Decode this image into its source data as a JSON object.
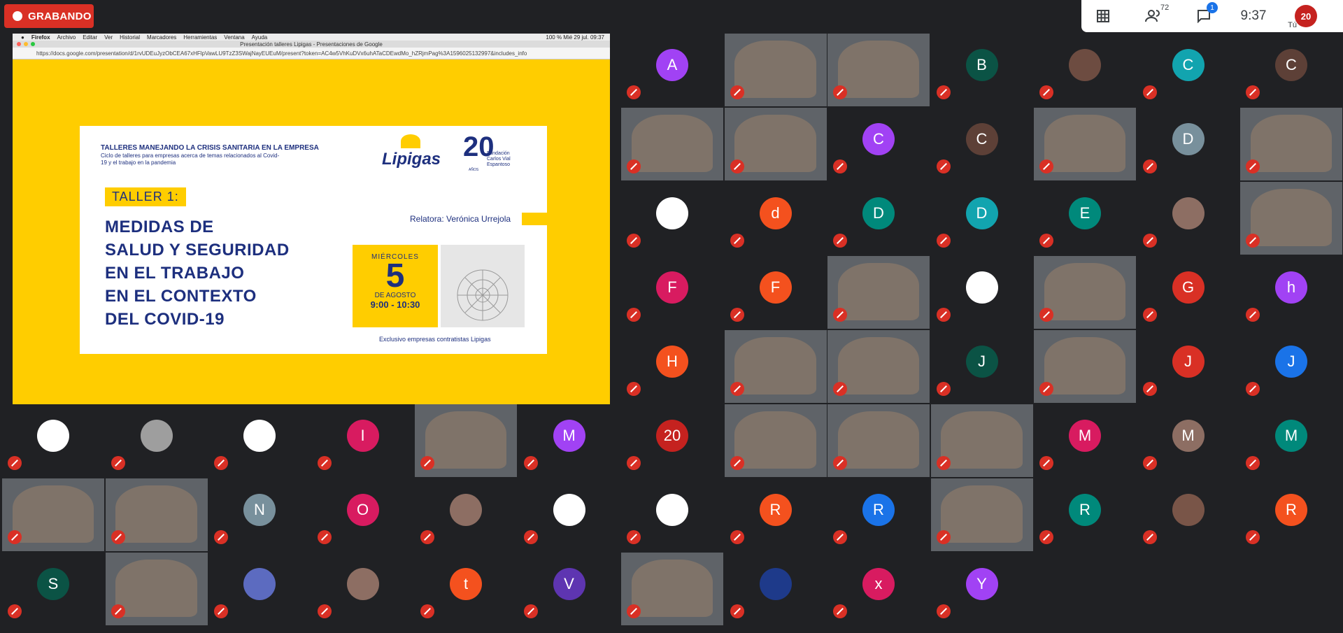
{
  "recording": {
    "label": "GRABANDO"
  },
  "topbar": {
    "participants_count": "72",
    "chat_badge": "1",
    "time": "9:37",
    "self_label": "Tú",
    "self_avatar": "20"
  },
  "presentation": {
    "mac_menu": [
      "Firefox",
      "Archivo",
      "Editar",
      "Ver",
      "Historial",
      "Marcadores",
      "Herramientas",
      "Ventana",
      "Ayuda"
    ],
    "mac_status": "100 %   Mié 29 jul.  09:37",
    "tab_title": "Presentación talleres Lipigas - Presentaciones de Google",
    "url": "https://docs.google.com/presentation/d/1rvUDEuJyzObCEA67xHFlpVawLU9TzZ3SWajNayEUEuM/present?token=AC4w5VhKuDVx6uhATaCDEwdMo_hZRjmPag%3A1596025132997&includes_info",
    "slide": {
      "header_title": "TALLERES MANEJANDO LA CRISIS SANITARIA EN LA EMPRESA",
      "header_subtitle": "Ciclo de talleres para empresas acerca de temas relacionados al Covid-19 y el trabajo en la pandemia",
      "taller": "TALLER 1:",
      "title_lines": [
        "MEDIDAS DE",
        "SALUD Y SEGURIDAD",
        "EN EL TRABAJO",
        "EN EL CONTEXTO",
        "DEL COVID-19"
      ],
      "logo_lipigas": "Lipigas",
      "logo_20": "20",
      "logo_fundacion": "Fundación Carlos Vial Espantoso",
      "logo_anos": "AÑOS",
      "relatora": "Relatora: Verónica Urrejola",
      "date_weekday": "MIÉRCOLES",
      "date_day": "5",
      "date_month": "DE AGOSTO",
      "date_time": "9:00 - 10:30",
      "exclusive": "Exclusivo empresas contratistas Lipigas"
    }
  },
  "tiles": [
    {
      "av": "A",
      "c": "#a142f4",
      "r": 0,
      "col": 0
    },
    {
      "v": 1,
      "r": 0,
      "col": 1
    },
    {
      "v": 1,
      "r": 0,
      "col": 2
    },
    {
      "av": "B",
      "c": "#0b5345",
      "r": 0,
      "col": 3
    },
    {
      "av": "",
      "c": "#6d4c41",
      "r": 0,
      "col": 4
    },
    {
      "av": "C",
      "c": "#12a4af",
      "r": 0,
      "col": 5
    },
    {
      "av": "C",
      "c": "#5d4037",
      "r": 0,
      "col": 6
    },
    {
      "v": 1,
      "r": 1,
      "col": 0
    },
    {
      "v": 1,
      "r": 1,
      "col": 1
    },
    {
      "av": "C",
      "c": "#a142f4",
      "r": 1,
      "col": 2
    },
    {
      "av": "C",
      "c": "#5d4037",
      "r": 1,
      "col": 3
    },
    {
      "v": 1,
      "r": 1,
      "col": 4
    },
    {
      "av": "D",
      "c": "#78909c",
      "r": 1,
      "col": 5
    },
    {
      "v": 1,
      "r": 1,
      "col": 6
    },
    {
      "av": "",
      "c": "#ffffff",
      "r": 2,
      "col": 0
    },
    {
      "av": "d",
      "c": "#f4511e",
      "r": 2,
      "col": 1
    },
    {
      "av": "D",
      "c": "#00897b",
      "r": 2,
      "col": 2
    },
    {
      "av": "D",
      "c": "#12a4af",
      "r": 2,
      "col": 3
    },
    {
      "av": "E",
      "c": "#00897b",
      "r": 2,
      "col": 4
    },
    {
      "av": "",
      "c": "#8d6e63",
      "r": 2,
      "col": 5
    },
    {
      "v": 1,
      "r": 2,
      "col": 6
    },
    {
      "av": "F",
      "c": "#d81b60",
      "r": 3,
      "col": 0
    },
    {
      "av": "F",
      "c": "#f4511e",
      "r": 3,
      "col": 1
    },
    {
      "v": 1,
      "r": 3,
      "col": 2
    },
    {
      "av": "",
      "c": "#ffffff",
      "r": 3,
      "col": 3
    },
    {
      "v": 1,
      "r": 3,
      "col": 4
    },
    {
      "av": "G",
      "c": "#d93025",
      "r": 3,
      "col": 5
    },
    {
      "av": "h",
      "c": "#a142f4",
      "r": 3,
      "col": 6
    },
    {
      "av": "H",
      "c": "#f4511e",
      "r": 4,
      "col": 0
    },
    {
      "v": 1,
      "r": 4,
      "col": 1
    },
    {
      "v": 1,
      "r": 4,
      "col": 2
    },
    {
      "av": "J",
      "c": "#0b5345",
      "r": 4,
      "col": 3
    },
    {
      "v": 1,
      "r": 4,
      "col": 4
    },
    {
      "av": "J",
      "c": "#d93025",
      "r": 4,
      "col": 5
    },
    {
      "av": "J",
      "c": "#1a73e8",
      "r": 4,
      "col": 6
    },
    {
      "av": "20",
      "c": "#c5221f",
      "r": 5,
      "col": 0
    },
    {
      "v": 1,
      "r": 5,
      "col": 1
    },
    {
      "v": 1,
      "r": 5,
      "col": 2
    },
    {
      "v": 1,
      "r": 5,
      "col": 3
    },
    {
      "av": "M",
      "c": "#d81b60",
      "r": 5,
      "col": 4
    },
    {
      "av": "M",
      "c": "#8d6e63",
      "r": 5,
      "col": 5
    },
    {
      "av": "M",
      "c": "#00897b",
      "r": 5,
      "col": 6
    },
    {
      "av": "",
      "c": "#ffffff",
      "r": 6,
      "col": 0
    },
    {
      "av": "R",
      "c": "#f4511e",
      "r": 6,
      "col": 1
    },
    {
      "av": "R",
      "c": "#1a73e8",
      "r": 6,
      "col": 2
    },
    {
      "v": 1,
      "r": 6,
      "col": 3
    },
    {
      "av": "R",
      "c": "#00897b",
      "r": 6,
      "col": 4
    },
    {
      "av": "",
      "c": "#795548",
      "r": 6,
      "col": 5
    },
    {
      "av": "R",
      "c": "#f4511e",
      "r": 6,
      "col": 6
    },
    {
      "v": 1,
      "r": 7,
      "col": 0
    },
    {
      "av": "",
      "c": "#1e3a8a",
      "r": 7,
      "col": 1
    },
    {
      "av": "x",
      "c": "#d81b60",
      "r": 7,
      "col": 2
    },
    {
      "av": "Y",
      "c": "#a142f4",
      "r": 7,
      "col": 3
    }
  ],
  "left_tiles": [
    {
      "av": "",
      "c": "#ffffff",
      "r": 0,
      "col": 0
    },
    {
      "av": "",
      "c": "#9e9e9e",
      "r": 0,
      "col": 1
    },
    {
      "av": "",
      "c": "#ffffff",
      "r": 0,
      "col": 2
    },
    {
      "av": "I",
      "c": "#d81b60",
      "r": 0,
      "col": 3
    },
    {
      "v": 1,
      "r": 0,
      "col": 4
    },
    {
      "av": "M",
      "c": "#a142f4",
      "r": 0,
      "col": 5
    },
    {
      "v": 1,
      "r": 1,
      "col": 0
    },
    {
      "v": 1,
      "r": 1,
      "col": 1
    },
    {
      "av": "N",
      "c": "#78909c",
      "r": 1,
      "col": 2
    },
    {
      "av": "O",
      "c": "#d81b60",
      "r": 1,
      "col": 3
    },
    {
      "av": "",
      "c": "#8d6e63",
      "r": 1,
      "col": 4
    },
    {
      "av": "",
      "c": "#ffffff",
      "r": 1,
      "col": 5
    },
    {
      "av": "S",
      "c": "#0b5345",
      "r": 2,
      "col": 0
    },
    {
      "v": 1,
      "r": 2,
      "col": 1
    },
    {
      "av": "",
      "c": "#5c6bc0",
      "r": 2,
      "col": 2
    },
    {
      "av": "",
      "c": "#8d6e63",
      "r": 2,
      "col": 3
    },
    {
      "av": "t",
      "c": "#f4511e",
      "r": 2,
      "col": 4
    },
    {
      "av": "V",
      "c": "#5e35b1",
      "r": 2,
      "col": 5
    }
  ]
}
